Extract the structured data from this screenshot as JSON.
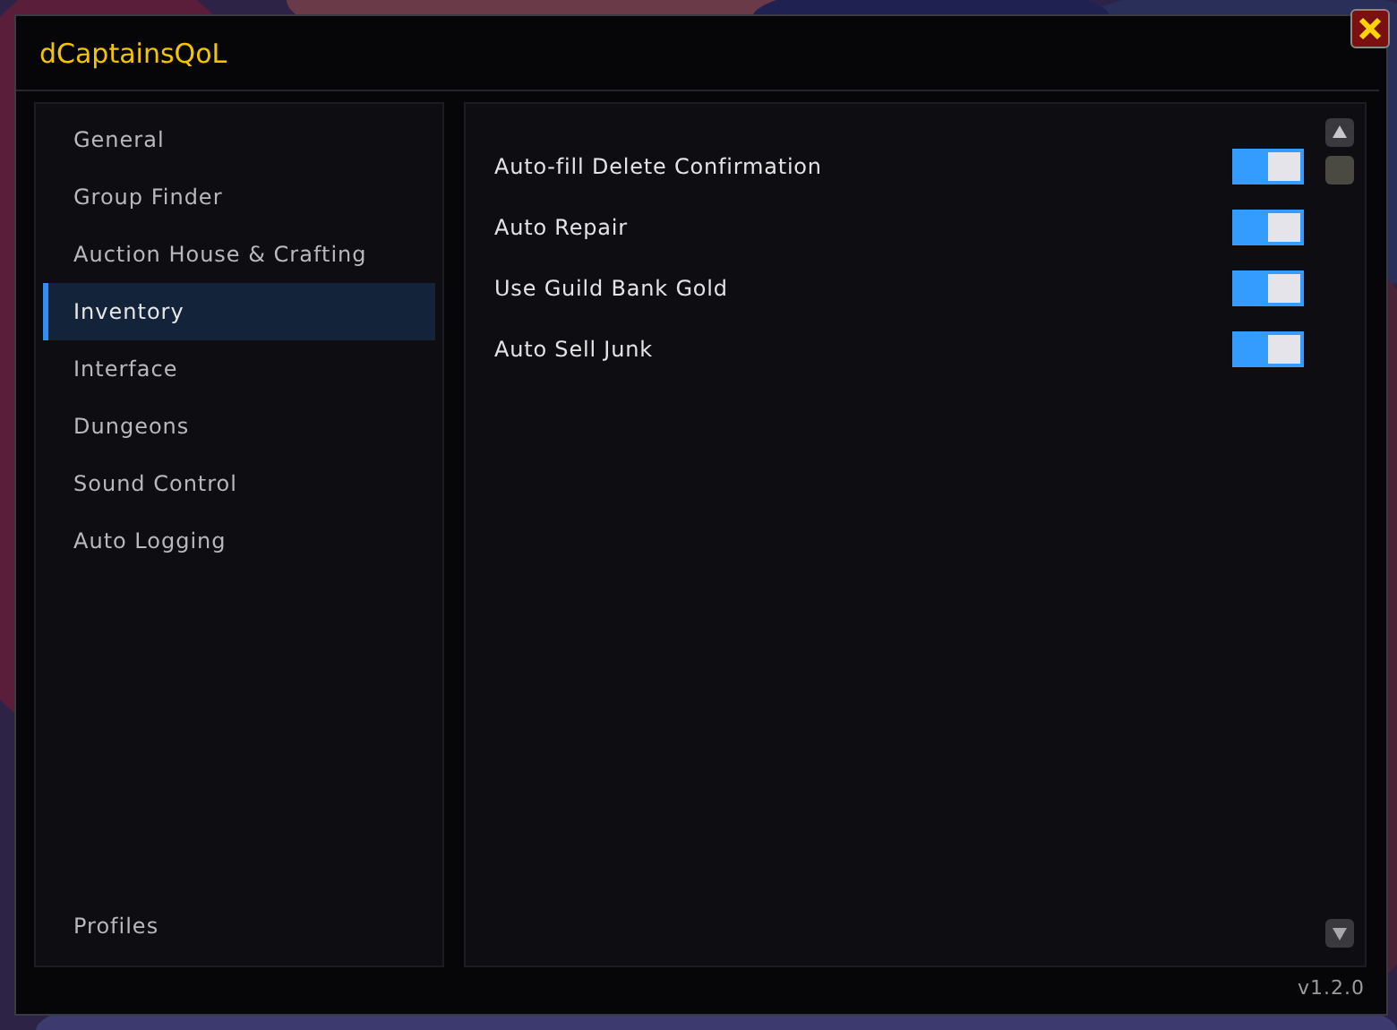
{
  "window": {
    "title": "dCaptainsQoL",
    "version": "v1.2.0"
  },
  "sidebar": {
    "items": [
      {
        "label": "General",
        "selected": false
      },
      {
        "label": "Group Finder",
        "selected": false
      },
      {
        "label": "Auction House & Crafting",
        "selected": false
      },
      {
        "label": "Inventory",
        "selected": true
      },
      {
        "label": "Interface",
        "selected": false
      },
      {
        "label": "Dungeons",
        "selected": false
      },
      {
        "label": "Sound Control",
        "selected": false
      },
      {
        "label": "Auto Logging",
        "selected": false
      }
    ],
    "footer_item": {
      "label": "Profiles",
      "selected": false
    }
  },
  "settings": [
    {
      "label": "Auto-fill Delete Confirmation",
      "on": true
    },
    {
      "label": "Auto Repair",
      "on": true
    },
    {
      "label": "Use Guild Bank Gold",
      "on": true
    },
    {
      "label": "Auto Sell Junk",
      "on": true
    }
  ]
}
